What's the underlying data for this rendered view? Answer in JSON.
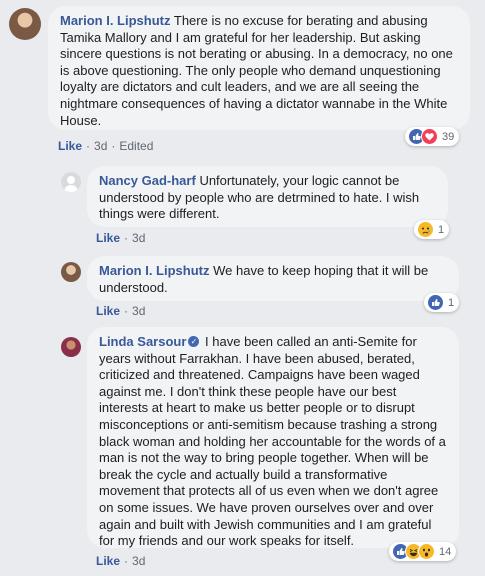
{
  "comments": [
    {
      "author": "Marion I. Lipshutz",
      "text": "There is no excuse for berating and abusing Tamika Mallory and I am grateful for her leadership. But asking sincere questions is not berating or abusing. In a democracy, no one is above questioning. The only people who demand unquestioning loyalty are dictators and cult leaders, and we are all seeing the nightmare consequences of having a dictator wannabe in the White House.",
      "like_label": "Like",
      "time": "3d",
      "edited": "Edited",
      "reactions": [
        "like-icon",
        "love-icon"
      ],
      "reaction_count": "39"
    },
    {
      "author": "Nancy Gad-harf",
      "text": "Unfortunately, your logic cannot be understood by people who are detrmined to hate. I wish things were different.",
      "like_label": "Like",
      "time": "3d",
      "reactions": [
        "sad-icon"
      ],
      "reaction_count": "1"
    },
    {
      "author": "Marion I. Lipshutz",
      "text": "We have to keep hoping that it will be understood.",
      "like_label": "Like",
      "time": "3d",
      "reactions": [
        "like-icon"
      ],
      "reaction_count": "1"
    },
    {
      "author": "Linda Sarsour",
      "verified_icon": "verified-badge-icon",
      "text": "I have been called an anti-Semite for years without Farrakhan. I have been abused, berated, criticized and threatened. Campaigns have been waged against me. I don't think these people have our best interests at heart to make us better people or to disrupt misconceptions or anti-semitism because trashing a strong black woman and holding her accountable for the words of a man is not the way to bring people together. When will be break the cycle and actually build a transformative movement that protects all of us even when we don't agree on some issues. We have proven ourselves over and over again and built with Jewish communities and I am grateful for my friends and our work speaks for itself.",
      "like_label": "Like",
      "time": "3d",
      "reactions": [
        "like-icon",
        "haha-icon",
        "wow-icon"
      ],
      "reaction_count": "14"
    }
  ],
  "colors": {
    "background": "#e9ebee",
    "bubble": "#f2f3f5",
    "author": "#385898",
    "like_blue": "#4267b2",
    "love_red": "#f33e58",
    "emoji_yellow": "#f7b928"
  }
}
